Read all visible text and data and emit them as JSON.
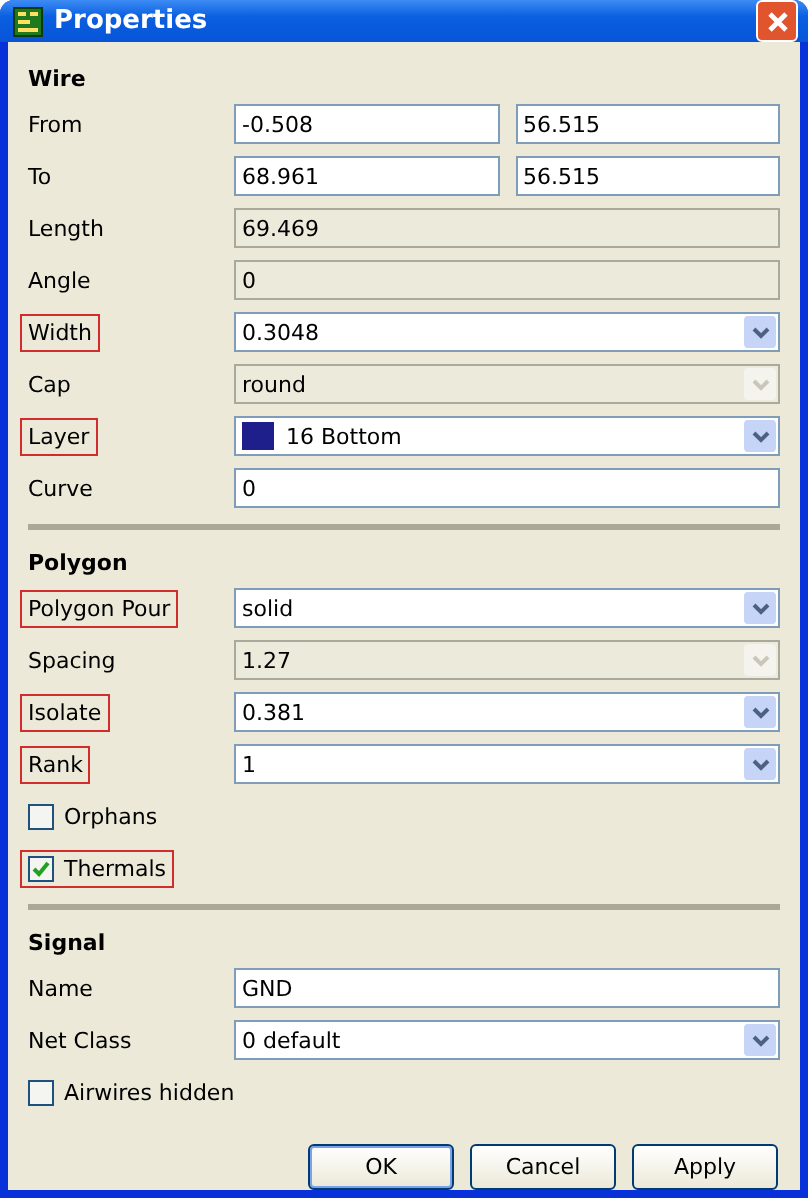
{
  "window": {
    "title": "Properties"
  },
  "sections": [
    {
      "title": "Wire",
      "rows": [
        {
          "kind": "pair",
          "label": "From",
          "highlighted": false,
          "values": [
            "-0.508",
            "56.515"
          ]
        },
        {
          "kind": "pair",
          "label": "To",
          "highlighted": false,
          "values": [
            "68.961",
            "56.515"
          ]
        },
        {
          "kind": "field",
          "label": "Length",
          "highlighted": false,
          "value": "69.469",
          "readonly": true
        },
        {
          "kind": "field",
          "label": "Angle",
          "highlighted": false,
          "value": "0",
          "readonly": true
        },
        {
          "kind": "combo",
          "label": "Width",
          "highlighted": true,
          "value": "0.3048",
          "disabled": false
        },
        {
          "kind": "combo",
          "label": "Cap",
          "highlighted": false,
          "value": "round",
          "disabled": true
        },
        {
          "kind": "combo",
          "label": "Layer",
          "highlighted": true,
          "value": "16 Bottom",
          "disabled": false,
          "color": "#1f1f8c"
        },
        {
          "kind": "field",
          "label": "Curve",
          "highlighted": false,
          "value": "0",
          "readonly": false
        }
      ]
    },
    {
      "title": "Polygon",
      "rows": [
        {
          "kind": "combo",
          "label": "Polygon Pour",
          "highlighted": true,
          "value": "solid",
          "disabled": false
        },
        {
          "kind": "combo",
          "label": "Spacing",
          "highlighted": false,
          "value": "1.27",
          "disabled": true
        },
        {
          "kind": "combo",
          "label": "Isolate",
          "highlighted": true,
          "value": "0.381",
          "disabled": false
        },
        {
          "kind": "combo",
          "label": "Rank",
          "highlighted": true,
          "value": "1",
          "disabled": false
        },
        {
          "kind": "checkbox",
          "label": "Orphans",
          "highlighted": false,
          "checked": false
        },
        {
          "kind": "checkbox",
          "label": "Thermals",
          "highlighted": true,
          "checked": true
        }
      ]
    },
    {
      "title": "Signal",
      "rows": [
        {
          "kind": "field",
          "label": "Name",
          "highlighted": false,
          "value": "GND",
          "readonly": false
        },
        {
          "kind": "combo",
          "label": "Net Class",
          "highlighted": false,
          "value": "0 default",
          "disabled": false
        },
        {
          "kind": "checkbox",
          "label": "Airwires hidden",
          "highlighted": false,
          "checked": false
        }
      ]
    }
  ],
  "buttons": [
    {
      "label": "OK",
      "default": true
    },
    {
      "label": "Cancel",
      "default": false
    },
    {
      "label": "Apply",
      "default": false
    }
  ]
}
